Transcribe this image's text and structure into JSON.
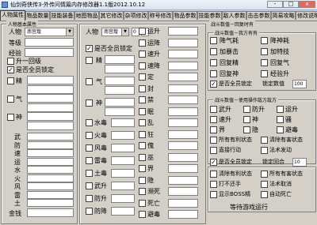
{
  "window": {
    "title": "仙剑奇侠传3-外传问情篇内存修改器1.1版2012.10.12",
    "min": "-",
    "max": "□",
    "close": "x"
  },
  "tabs": [
    "人物属性",
    "物品数量",
    "技能装备",
    "地图物品",
    "其它修改",
    "杂项修改",
    "称号修改",
    "物品参数",
    "技能参数",
    "敌人参数",
    "击击参数",
    "简易攻略",
    "修改说明"
  ],
  "left": {
    "group_title": "人物基本属性",
    "person_label": "人物",
    "person_value": "南宫煌",
    "level_label": "等级",
    "exp_label": "经验",
    "levelup_label": "升一回级",
    "lock_label": "是否全员锁定",
    "jing": "精",
    "qi": "气",
    "shen": "神",
    "attrs": [
      "武",
      "防",
      "速",
      "运",
      "水",
      "火",
      "风",
      "雷",
      "土"
    ],
    "money_label": "金钱"
  },
  "mid": {
    "person_label": "人物",
    "person_value": "南宫煌",
    "n1": "0",
    "n2": "0",
    "lock_label": "是否全员锁定",
    "jing": "精",
    "qi": "气",
    "shen": "神",
    "col1": [
      "水毒",
      "火毒",
      "风毒",
      "雷毒",
      "土毒",
      "武升",
      "防升",
      "防降"
    ],
    "col2": [
      "运升",
      "运降",
      "速升",
      "速降",
      "定",
      "封",
      "禁",
      "眠",
      "乱",
      "狂",
      "傀",
      "巫",
      "界",
      "隐",
      "濒死",
      "死亡",
      "避毒"
    ]
  },
  "right": {
    "g1_title": "战斗数值－回复时有",
    "g2_title": "战斗数值－我方有有",
    "g2": [
      [
        "降气耗",
        "降神耗"
      ],
      [
        "加暴击",
        "加特技"
      ],
      [
        "回复精",
        "回复气"
      ],
      [
        "回复神",
        "经验升"
      ]
    ],
    "g2_lock": "是否全员锁定",
    "g2_lock2": "锁定数值",
    "g2_value": "100",
    "g3_title": "战斗数值－使用操作敌方敌方",
    "g3": [
      [
        "武升",
        "防升",
        "运升"
      ],
      [
        "速升",
        "神",
        "骚"
      ],
      [
        "界",
        "隐",
        "避毒"
      ]
    ],
    "g3_rows": [
      "所有有利状态",
      "清除有害状态",
      "直接行动",
      "法术发动"
    ],
    "g3_lock": "是否全员锁定",
    "g3_lock2": "锁定回合",
    "g3_value": "10",
    "g4": [
      "清除有利状态",
      "所有有害状态",
      "打不还手",
      "法术取消",
      "显示BOSS精",
      "自动死亡"
    ],
    "wait": "等待游戏运行"
  }
}
